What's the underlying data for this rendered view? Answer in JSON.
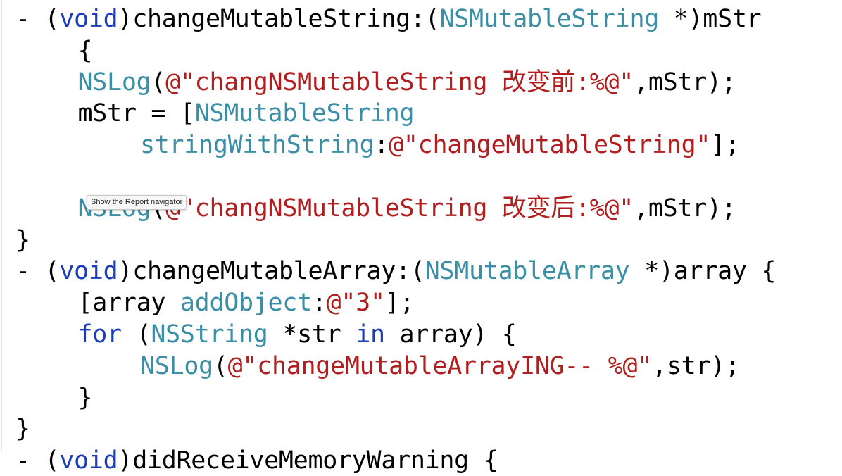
{
  "colors": {
    "plain": "#000000",
    "keyword": "#1b3db8",
    "type": "#3a8fa6",
    "string": "#b21d1d"
  },
  "tooltip": {
    "text": "Show the Report navigator"
  },
  "lines": [
    {
      "indent": 0,
      "tokens": [
        {
          "t": "- (",
          "c": "plain"
        },
        {
          "t": "void",
          "c": "keyword"
        },
        {
          "t": ")changeMutableString:(",
          "c": "plain"
        },
        {
          "t": "NSMutableString",
          "c": "type"
        },
        {
          "t": " *)mStr",
          "c": "plain"
        }
      ]
    },
    {
      "indent": 3,
      "tokens": [
        {
          "t": "{",
          "c": "plain"
        }
      ]
    },
    {
      "indent": 3,
      "tokens": [
        {
          "t": "NSLog",
          "c": "type"
        },
        {
          "t": "(",
          "c": "plain"
        },
        {
          "t": "@\"changNSMutableString 改变前:%@\"",
          "c": "string"
        },
        {
          "t": ",mStr);",
          "c": "plain"
        }
      ]
    },
    {
      "indent": 3,
      "tokens": [
        {
          "t": "mStr = [",
          "c": "plain"
        },
        {
          "t": "NSMutableString",
          "c": "type"
        }
      ]
    },
    {
      "indent": 6,
      "tokens": [
        {
          "t": "stringWithString",
          "c": "type"
        },
        {
          "t": ":",
          "c": "plain"
        },
        {
          "t": "@\"changeMutableString\"",
          "c": "string"
        },
        {
          "t": "];",
          "c": "plain"
        }
      ]
    },
    {
      "indent": 0,
      "tokens": []
    },
    {
      "indent": 3,
      "tokens": [
        {
          "t": "NSLog",
          "c": "type"
        },
        {
          "t": "(",
          "c": "plain"
        },
        {
          "t": "@\"changNSMutableString 改变后:%@\"",
          "c": "string"
        },
        {
          "t": ",mStr);",
          "c": "plain"
        }
      ]
    },
    {
      "indent": 0,
      "tokens": [
        {
          "t": "}",
          "c": "plain"
        }
      ]
    },
    {
      "indent": 0,
      "tokens": [
        {
          "t": "- (",
          "c": "plain"
        },
        {
          "t": "void",
          "c": "keyword"
        },
        {
          "t": ")changeMutableArray:(",
          "c": "plain"
        },
        {
          "t": "NSMutableArray",
          "c": "type"
        },
        {
          "t": " *)array {",
          "c": "plain"
        }
      ]
    },
    {
      "indent": 3,
      "tokens": [
        {
          "t": "[array ",
          "c": "plain"
        },
        {
          "t": "addObject",
          "c": "type"
        },
        {
          "t": ":",
          "c": "plain"
        },
        {
          "t": "@\"3\"",
          "c": "string"
        },
        {
          "t": "];",
          "c": "plain"
        }
      ]
    },
    {
      "indent": 3,
      "tokens": [
        {
          "t": "for",
          "c": "keyword"
        },
        {
          "t": " (",
          "c": "plain"
        },
        {
          "t": "NSString",
          "c": "type"
        },
        {
          "t": " *str ",
          "c": "plain"
        },
        {
          "t": "in",
          "c": "keyword"
        },
        {
          "t": " array) {",
          "c": "plain"
        }
      ]
    },
    {
      "indent": 6,
      "tokens": [
        {
          "t": "NSLog",
          "c": "type"
        },
        {
          "t": "(",
          "c": "plain"
        },
        {
          "t": "@\"changeMutableArrayING-- %@\"",
          "c": "string"
        },
        {
          "t": ",str);",
          "c": "plain"
        }
      ]
    },
    {
      "indent": 3,
      "tokens": [
        {
          "t": "}",
          "c": "plain"
        }
      ]
    },
    {
      "indent": 0,
      "tokens": [
        {
          "t": "}",
          "c": "plain"
        }
      ]
    },
    {
      "indent": 0,
      "tokens": [
        {
          "t": "- (",
          "c": "plain"
        },
        {
          "t": "void",
          "c": "keyword"
        },
        {
          "t": ")didReceiveMemoryWarning {",
          "c": "plain"
        }
      ]
    }
  ]
}
